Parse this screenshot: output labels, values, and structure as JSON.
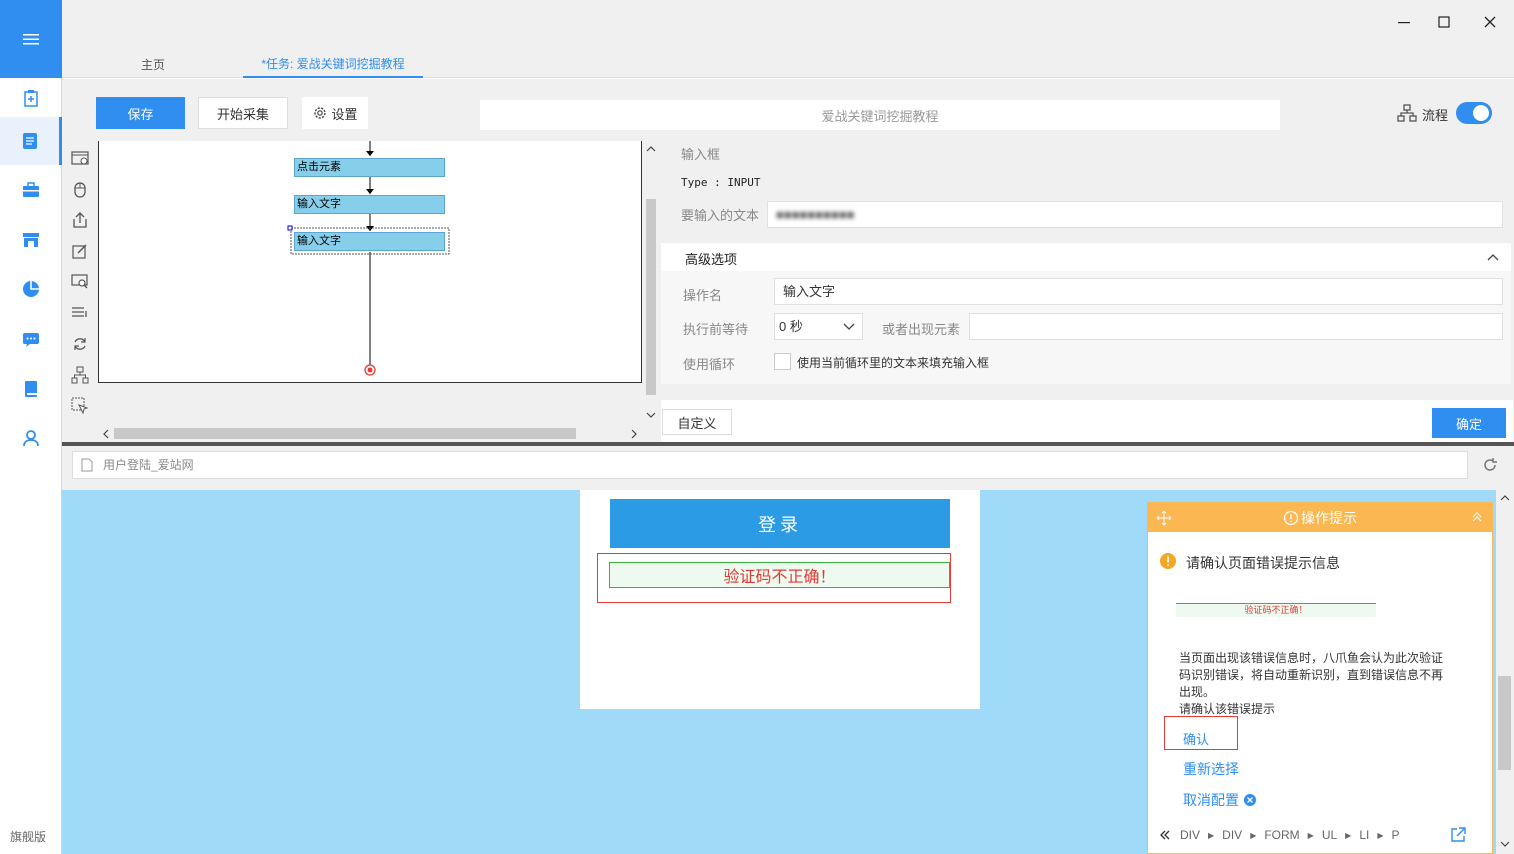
{
  "sidebar": {
    "items": [
      "task-list-icon",
      "task-edit-icon",
      "toolbox-icon",
      "store-icon",
      "chart-pie-icon",
      "message-icon",
      "book-icon",
      "user-icon"
    ],
    "edition": "旗舰版"
  },
  "tabs": [
    {
      "label": "主页"
    },
    {
      "label": "*任务: 爱战关键词挖掘教程"
    }
  ],
  "toolbar": {
    "save": "保存",
    "start": "开始采集",
    "settings": "设置",
    "task_name": "爱战关键词挖掘教程",
    "flow_label": "流程"
  },
  "flow": {
    "nodes": [
      "点击元素",
      "输入文字",
      "输入文字"
    ]
  },
  "props": {
    "section_title": "输入框",
    "type_line": "Type : INPUT",
    "input_text_label": "要输入的文本",
    "input_text_value": "■■■■■■■■■■",
    "advanced": "高级选项",
    "op_name_label": "操作名",
    "op_name_value": "输入文字",
    "wait_label": "执行前等待",
    "wait_value": "0 秒",
    "or_element_label": "或者出现元素",
    "loop_label": "使用循环",
    "loop_checkbox": "使用当前循环里的文本来填充输入框",
    "custom": "自定义",
    "confirm": "确定"
  },
  "address": {
    "title": "用户登陆_爱站网"
  },
  "page": {
    "login": "登录",
    "error": "验证码不正确！"
  },
  "hint": {
    "title": "操作提示",
    "question": "请确认页面错误提示信息",
    "preview": "验证码不正确！",
    "desc1": "当页面出现该错误信息时，八爪鱼会认为此次验证",
    "desc2": "码识别错误，将自动重新识别，直到错误信息不再",
    "desc3": "出现。",
    "desc4": "请确认该错误提示",
    "confirm": "确认",
    "reselect": "重新选择",
    "cancel": "取消配置",
    "breadcrumb": [
      "DIV",
      "DIV",
      "FORM",
      "UL",
      "LI",
      "P"
    ]
  },
  "colors": {
    "accent": "#2f8ef0",
    "hint": "#fbb752",
    "error": "#e53935",
    "browser_bg": "#9fdaf8"
  }
}
